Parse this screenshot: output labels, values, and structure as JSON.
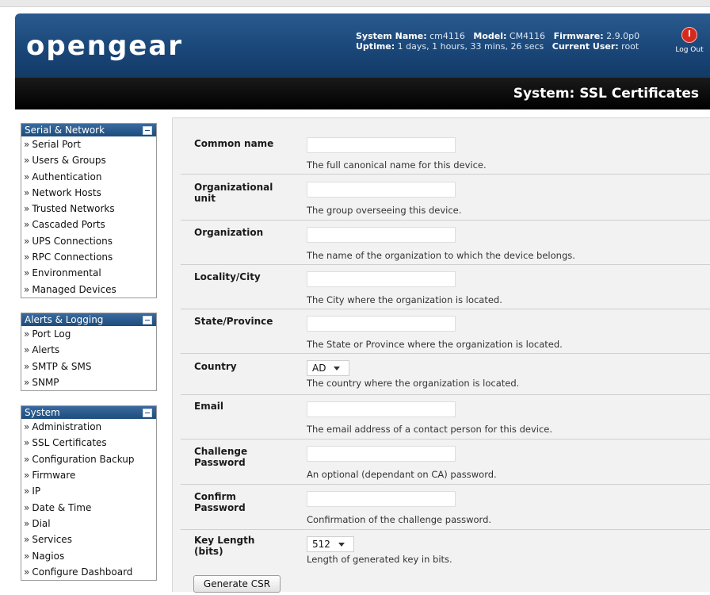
{
  "header": {
    "logo": "opengear",
    "system_name_label": "System Name:",
    "system_name": "cm4116",
    "model_label": "Model:",
    "model": "CM4116",
    "firmware_label": "Firmware:",
    "firmware": "2.9.0p0",
    "uptime_label": "Uptime:",
    "uptime": "1 days, 1 hours, 33 mins, 26 secs",
    "current_user_label": "Current User:",
    "current_user": "root",
    "logout_label": "Log Out",
    "page_title": "System: SSL Certificates"
  },
  "sidebar": {
    "sections": [
      {
        "title": "Serial & Network",
        "items": [
          "Serial Port",
          "Users & Groups",
          "Authentication",
          "Network Hosts",
          "Trusted Networks",
          "Cascaded Ports",
          "UPS Connections",
          "RPC Connections",
          "Environmental",
          "Managed Devices"
        ]
      },
      {
        "title": "Alerts & Logging",
        "items": [
          "Port Log",
          "Alerts",
          "SMTP & SMS",
          "SNMP"
        ]
      },
      {
        "title": "System",
        "items": [
          "Administration",
          "SSL Certificates",
          "Configuration Backup",
          "Firmware",
          "IP",
          "Date & Time",
          "Dial",
          "Services",
          "Nagios",
          "Configure Dashboard"
        ]
      }
    ],
    "arrow": "»"
  },
  "form": {
    "fields": [
      {
        "label": "Common name",
        "description": "The full canonical name for this device.",
        "value": ""
      },
      {
        "label": "Organizational unit",
        "description": "The group overseeing this device.",
        "value": ""
      },
      {
        "label": "Organization",
        "description": "The name of the organization to which the device belongs.",
        "value": ""
      },
      {
        "label": "Locality/City",
        "description": "The City where the organization is located.",
        "value": ""
      },
      {
        "label": "State/Province",
        "description": "The State or Province where the organization is located.",
        "value": ""
      },
      {
        "label": "Country",
        "description": "The country where the organization is located.",
        "value": "AD"
      },
      {
        "label": "Email",
        "description": "The email address of a contact person for this device.",
        "value": ""
      },
      {
        "label": "Challenge Password",
        "description": "An optional (dependant on CA) password.",
        "value": ""
      },
      {
        "label": "Confirm Password",
        "description": "Confirmation of the challenge password.",
        "value": ""
      },
      {
        "label": "Key Length (bits)",
        "description": "Length of generated key in bits.",
        "value": "512"
      }
    ],
    "submit_label": "Generate CSR"
  }
}
